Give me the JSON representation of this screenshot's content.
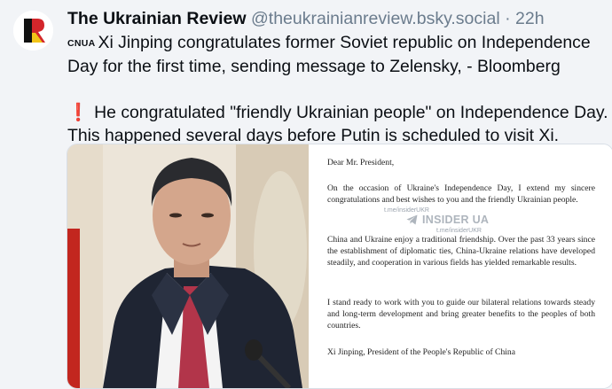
{
  "post": {
    "author_name": "The Ukrainian Review",
    "handle": "@theukrainianreview.bsky.social",
    "separator": "·",
    "time": "22h",
    "flag_label": "CNUA",
    "line1": "Xi Jinping congratulates former Soviet republic on Independence Day for the first time, sending message to Zelensky, - Bloomberg",
    "exclamation": "❗",
    "line2": "He congratulated \"friendly Ukrainian people\" on Independence Day. This happened several days before Putin is scheduled to visit Xi."
  },
  "letter": {
    "salutation": "Dear Mr. President,",
    "p1": "On the occasion of Ukraine's Independence Day, I extend my sincere congratulations and best wishes to you and the friendly Ukrainian people.",
    "p2": "China and Ukraine enjoy a traditional friendship. Over the past 33 years since the establishment of diplomatic ties, China-Ukraine relations have developed steadily, and cooperation in various fields has yielded remarkable results.",
    "p3": "I stand ready to work with you to guide our bilateral relations towards steady and long-term development and bring greater benefits to the peoples of both countries.",
    "signature": "Xi Jinping, President of the People's Republic of China",
    "watermark_small": "t.me/insiderUKR",
    "watermark_big": "INSIDER UA"
  },
  "colors": {
    "background": "#f2f4f7",
    "handle": "#6b7c8d",
    "logo_red": "#d3262b",
    "logo_yellow": "#f2c418"
  },
  "icons": [
    "avatar-logo",
    "telegram-icon"
  ]
}
